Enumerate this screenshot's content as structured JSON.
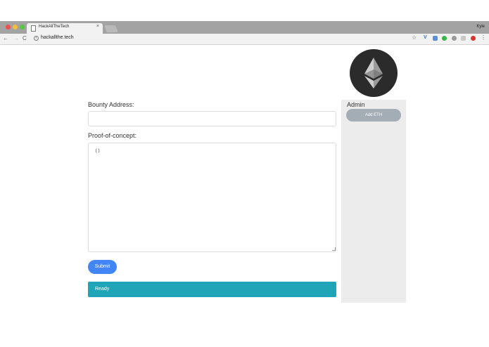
{
  "browser": {
    "tab_title": "HackAllTheTech",
    "tab_close": "×",
    "profile_name": "Kyle",
    "url": "hackallthe.tech",
    "icons": [
      "back-icon",
      "forward-icon",
      "reload-icon",
      "info-icon",
      "star-icon",
      "extension-icons",
      "menu-icon"
    ]
  },
  "form": {
    "bounty_label": "Bounty Address:",
    "bounty_value": "",
    "poc_label": "Proof-of-concept:",
    "poc_value": "()",
    "submit_label": "Submit",
    "status_text": "Ready"
  },
  "admin": {
    "title": "Admin",
    "add_eth_label": "Add ETH"
  },
  "colors": {
    "submit": "#4285f4",
    "status": "#20a4b8",
    "admin_button": "#a3adb6",
    "admin_panel": "#ececec"
  }
}
